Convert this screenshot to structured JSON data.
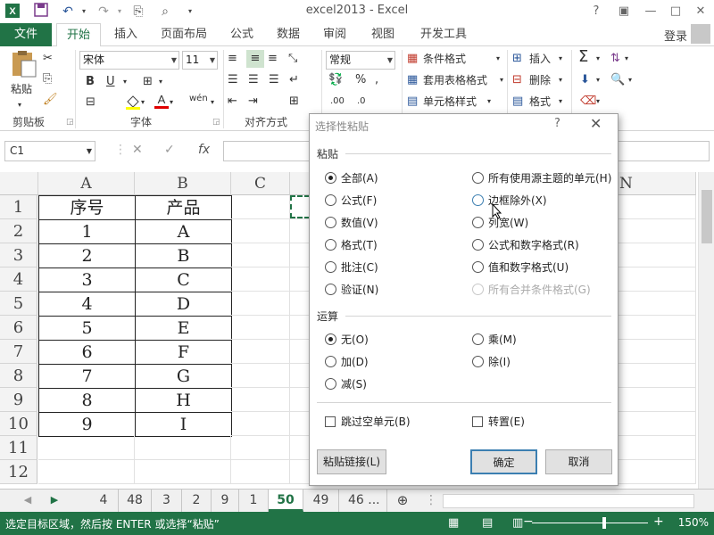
{
  "app": {
    "title": "excel2013 - Excel"
  },
  "window": {
    "help": "?",
    "minimize": "—",
    "maximize": "□",
    "close": "✕"
  },
  "tabs": [
    "文件",
    "开始",
    "插入",
    "页面布局",
    "公式",
    "数据",
    "审阅",
    "视图",
    "开发工具"
  ],
  "account": {
    "login": "登录"
  },
  "ribbon": {
    "clipboard": {
      "label": "剪贴板",
      "paste": "粘贴"
    },
    "font": {
      "label": "字体",
      "name": "宋体",
      "size": "11",
      "bold": "B",
      "underline": "U",
      "wen": "wén"
    },
    "align": {
      "label": "对齐方式"
    },
    "number": {
      "format": "常规"
    },
    "styles": {
      "conditional": "条件格式",
      "table": "套用表格格式",
      "cell": "单元格样式"
    },
    "cells": {
      "insert": "插入",
      "delete": "删除",
      "format": "格式"
    }
  },
  "formula_bar": {
    "name_box": "C1",
    "cancel": "✕",
    "enter": "✓",
    "fx": "fx"
  },
  "grid": {
    "columns": [
      "A",
      "B",
      "C",
      "N"
    ],
    "rows": [
      "1",
      "2",
      "3",
      "4",
      "5",
      "6",
      "7",
      "8",
      "9",
      "10",
      "11",
      "12"
    ],
    "header": [
      "序号",
      "产品"
    ],
    "data": [
      [
        "1",
        "A"
      ],
      [
        "2",
        "B"
      ],
      [
        "3",
        "C"
      ],
      [
        "4",
        "D"
      ],
      [
        "5",
        "E"
      ],
      [
        "6",
        "F"
      ],
      [
        "7",
        "G"
      ],
      [
        "8",
        "H"
      ],
      [
        "9",
        "I"
      ]
    ]
  },
  "sheets": [
    "4",
    "48",
    "3",
    "2",
    "9",
    "1",
    "50",
    "49",
    "46 ..."
  ],
  "active_sheet": "50",
  "status": {
    "message": "选定目标区域，然后按 ENTER 或选择“粘贴”",
    "zoom": "150%"
  },
  "dialog": {
    "title": "选择性粘贴",
    "help": "?",
    "paste_label": "粘贴",
    "paste_left": [
      "全部(A)",
      "公式(F)",
      "数值(V)",
      "格式(T)",
      "批注(C)",
      "验证(N)"
    ],
    "paste_right": [
      "所有使用源主题的单元(H)",
      "边框除外(X)",
      "列宽(W)",
      "公式和数字格式(R)",
      "值和数字格式(U)",
      "所有合并条件格式(G)"
    ],
    "operation_label": "运算",
    "op_left": [
      "无(O)",
      "加(D)",
      "减(S)"
    ],
    "op_right": [
      "乘(M)",
      "除(I)"
    ],
    "skip_blanks": "跳过空单元(B)",
    "transpose": "转置(E)",
    "paste_link": "粘贴链接(L)",
    "ok": "确定",
    "cancel": "取消"
  }
}
